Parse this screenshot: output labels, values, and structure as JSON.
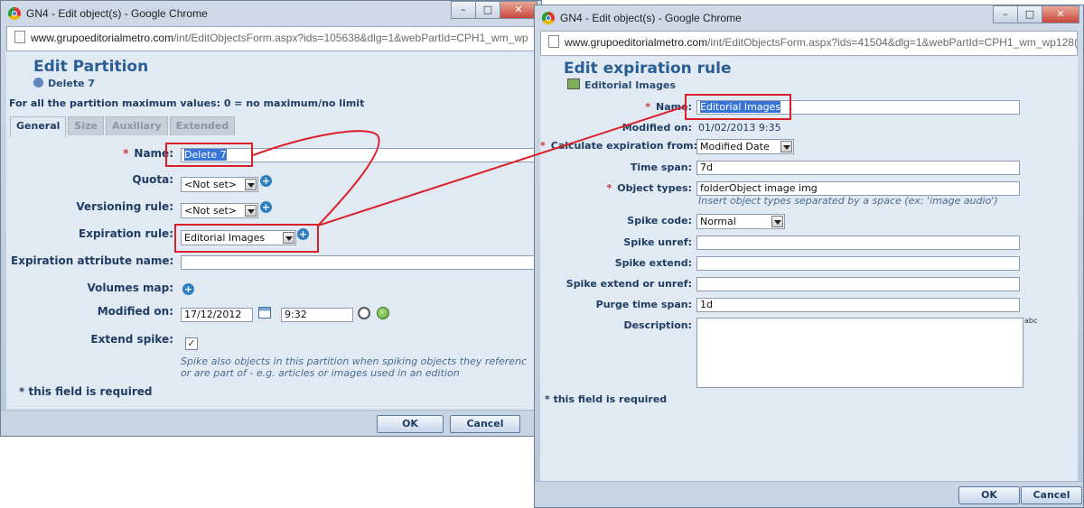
{
  "left_window": {
    "title": "GN4 - Edit object(s) - Google Chrome",
    "url_host": "www.grupoeditorialmetro.com",
    "url_path": "/int/EditObjectsForm.aspx?ids=105638&dlg=1&webPartId=CPH1_wm_wp",
    "heading": "Edit Partition",
    "subheading": "Delete 7",
    "info": "For all the partition maximum values: 0 = no maximum/no limit",
    "tabs": [
      "General",
      "Size",
      "Auxiliary",
      "Extended"
    ],
    "fields": {
      "name_label": "Name:",
      "name_value": "Delete 7",
      "quota_label": "Quota:",
      "quota_value": "<Not set>",
      "versioning_label": "Versioning rule:",
      "versioning_value": "<Not set>",
      "expiration_label": "Expiration rule:",
      "expiration_value": "Editorial Images",
      "exp_attr_label": "Expiration attribute name:",
      "exp_attr_value": "",
      "volumes_label": "Volumes map:",
      "modified_label": "Modified on:",
      "modified_date": "17/12/2012",
      "modified_time": "9:32",
      "extend_label": "Extend spike:",
      "extend_checked": "✓",
      "spike_note_1": "Spike also objects in this partition when spiking objects they referenc",
      "spike_note_2": "or are part of - e.g. articles or images used in an edition"
    },
    "required_note": "* this field is required",
    "ok_label": "OK",
    "cancel_label": "Cancel"
  },
  "right_window": {
    "title": "GN4 - Edit object(s) - Google Chrome",
    "url_host": "www.grupoeditorialmetro.com",
    "url_path": "/int/EditObjectsForm.aspx?ids=41504&dlg=1&webPartId=CPH1_wm_wp128(",
    "heading": "Edit expiration rule",
    "subheading": "Editorial Images",
    "fields": {
      "name_label": "Name:",
      "name_value": "Editorial Images",
      "modified_label": "Modified on:",
      "modified_value": "01/02/2013 9:35",
      "calc_label": "Calculate expiration from:",
      "calc_value": "Modified Date",
      "timespan_label": "Time span:",
      "timespan_value": "7d",
      "objtypes_label": "Object types:",
      "objtypes_value": "folderObject image img",
      "objtypes_note": "Insert object types separated by a space (ex: 'image audio')",
      "spikecode_label": "Spike code:",
      "spikecode_value": "Normal",
      "spikeunref_label": "Spike unref:",
      "spikeextend_label": "Spike extend:",
      "spikeextunref_label": "Spike extend or unref:",
      "purge_label": "Purge time span:",
      "purge_value": "1d",
      "desc_label": "Description:",
      "spell_icon": "abc"
    },
    "required_note": "* this field is required",
    "ok_label": "OK",
    "cancel_label": "Cancel"
  },
  "window_buttons": {
    "minimize": "–",
    "maximize": "□",
    "close": "✕"
  },
  "colors": {
    "highlight": "#d9202a",
    "heading": "#2a5d93",
    "panel": "#e1eaf3",
    "selection": "#3875d7"
  }
}
